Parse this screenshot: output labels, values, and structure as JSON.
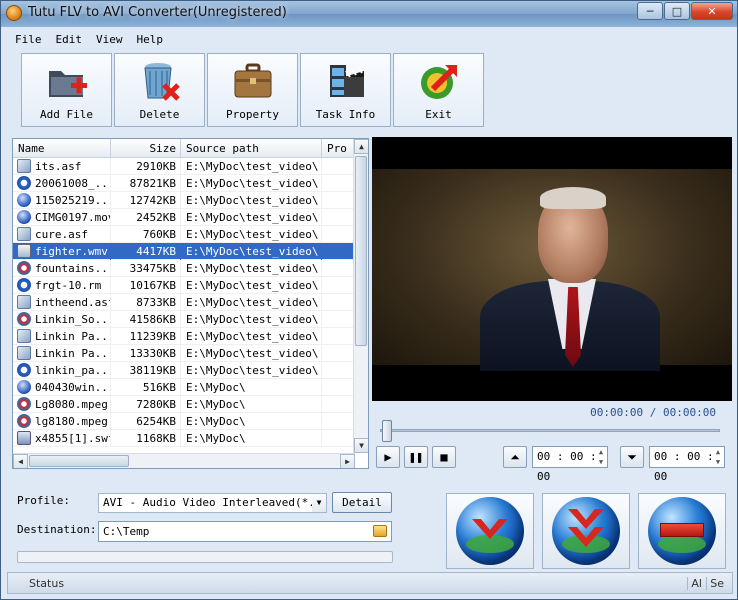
{
  "window": {
    "title": "Tutu FLV to AVI Converter(Unregistered)",
    "controls": {
      "minimize": "─",
      "maximize": "□",
      "close": "✕"
    }
  },
  "menu": [
    "File",
    "Edit",
    "View",
    "Help"
  ],
  "toolbar": [
    {
      "label": "Add File",
      "icon": "folder-add-icon"
    },
    {
      "label": "Delete",
      "icon": "trash-delete-icon"
    },
    {
      "label": "Property",
      "icon": "briefcase-icon"
    },
    {
      "label": "Task Info",
      "icon": "film-clapper-icon"
    },
    {
      "label": "Exit",
      "icon": "exit-arrow-icon"
    }
  ],
  "file_list": {
    "columns": [
      "Name",
      "Size",
      "Source path",
      "Pro"
    ],
    "rows": [
      {
        "name": "its.asf",
        "size": "2910KB",
        "path": "E:\\MyDoc\\test_video\\",
        "type": "asf"
      },
      {
        "name": "20061008_...",
        "size": "87821KB",
        "path": "E:\\MyDoc\\test_video\\",
        "type": "rm"
      },
      {
        "name": "115025219...",
        "size": "12742KB",
        "path": "E:\\MyDoc\\test_video\\",
        "type": "mov"
      },
      {
        "name": "CIMG0197.mov",
        "size": "2452KB",
        "path": "E:\\MyDoc\\test_video\\",
        "type": "mov"
      },
      {
        "name": "cure.asf",
        "size": "760KB",
        "path": "E:\\MyDoc\\test_video\\",
        "type": "asf"
      },
      {
        "name": "fighter.wmv",
        "size": "4417KB",
        "path": "E:\\MyDoc\\test_video\\",
        "type": "wmv",
        "selected": true
      },
      {
        "name": "fountains...",
        "size": "33475KB",
        "path": "E:\\MyDoc\\test_video\\",
        "type": "mpeg"
      },
      {
        "name": "frgt-10.rm",
        "size": "10167KB",
        "path": "E:\\MyDoc\\test_video\\",
        "type": "rm"
      },
      {
        "name": "intheend.asf",
        "size": "8733KB",
        "path": "E:\\MyDoc\\test_video\\",
        "type": "asf"
      },
      {
        "name": "Linkin_So...",
        "size": "41586KB",
        "path": "E:\\MyDoc\\test_video\\",
        "type": "mpeg"
      },
      {
        "name": "Linkin Pa...",
        "size": "11239KB",
        "path": "E:\\MyDoc\\test_video\\",
        "type": "asf"
      },
      {
        "name": "Linkin Pa...",
        "size": "13330KB",
        "path": "E:\\MyDoc\\test_video\\",
        "type": "asf"
      },
      {
        "name": "linkin_pa...",
        "size": "38119KB",
        "path": "E:\\MyDoc\\test_video\\",
        "type": "rm"
      },
      {
        "name": "040430win...",
        "size": "516KB",
        "path": "E:\\MyDoc\\",
        "type": "mov"
      },
      {
        "name": "Lg8080.mpeg",
        "size": "7280KB",
        "path": "E:\\MyDoc\\",
        "type": "mpeg"
      },
      {
        "name": "lg8180.mpeg",
        "size": "6254KB",
        "path": "E:\\MyDoc\\",
        "type": "mpeg"
      },
      {
        "name": "x4855[1].swf",
        "size": "1168KB",
        "path": "E:\\MyDoc\\",
        "type": "swf"
      }
    ]
  },
  "player": {
    "time_display": "00:00:00 / 00:00:00",
    "start_time": "00 : 00 : 00",
    "end_time": "00 : 00 : 00",
    "seek_position": 0
  },
  "output": {
    "profile_label": "Profile:",
    "profile_value": "AVI - Audio Video Interleaved(*.avi)",
    "detail_label": "Detail",
    "destination_label": "Destination:",
    "destination_value": "C:\\Temp",
    "progress": 0
  },
  "actions": [
    {
      "icon": "convert-globe-icon"
    },
    {
      "icon": "convert-all-globe-icon"
    },
    {
      "icon": "stop-globe-icon"
    }
  ],
  "status": {
    "text": "Status",
    "right1": "Al",
    "right2": "Se"
  }
}
